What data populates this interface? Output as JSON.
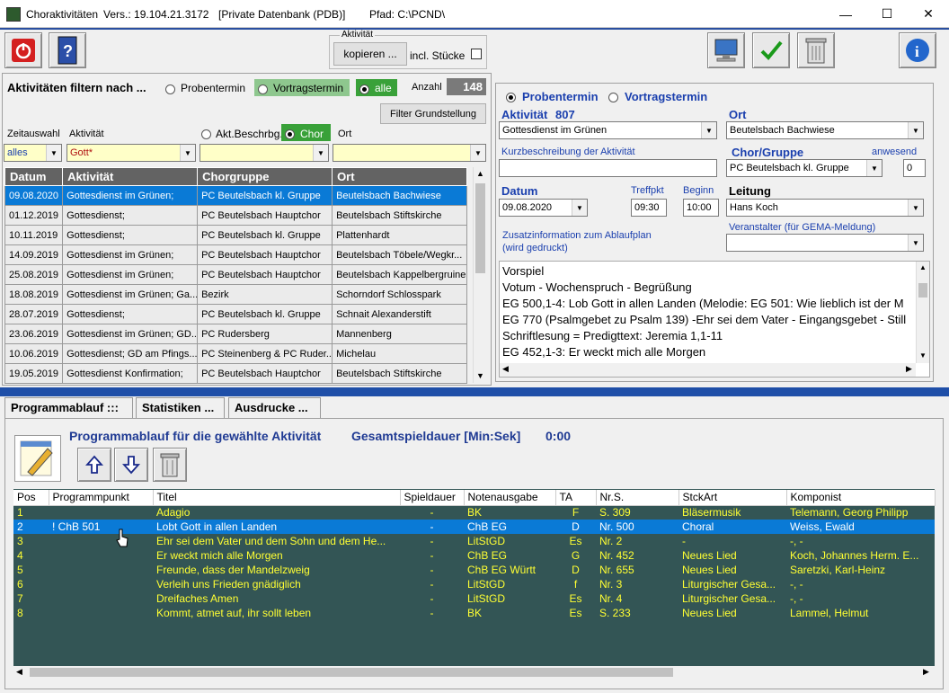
{
  "window": {
    "app_title": "Choraktivitäten",
    "version": "Vers.: 19.104.21.3172",
    "db": "[Private Datenbank (PDB)]",
    "path": "Pfad: C:\\PCND\\",
    "minimize": "—",
    "maximize": "☐",
    "close": "✕"
  },
  "toolbar": {
    "activity_group_label": "Aktivität",
    "copy_button": "kopieren ...",
    "incl_stuecke": "incl. Stücke"
  },
  "filter": {
    "title": "Aktivitäten filtern nach ...",
    "opt_probentermin": "Probentermin",
    "opt_vortragstermin": "Vortragstermin",
    "opt_alle": "alle",
    "anzahl_label": "Anzahl",
    "anzahl_value": "148",
    "grundstellung_button": "Filter Grundstellung",
    "zeitauswahl_label": "Zeitauswahl",
    "aktivitaet_label": "Aktivität",
    "akt_beschr_label": "Akt.Beschrbg.",
    "chor_label": "Chor",
    "ort_label": "Ort",
    "zeitauswahl_value": "alles",
    "aktivitaet_value": "Gott*",
    "chor_value": "",
    "ort_value": ""
  },
  "activities": {
    "headers": [
      "Datum",
      "Aktivität",
      "Chorgruppe",
      "Ort"
    ],
    "rows": [
      [
        "09.08.2020",
        "Gottesdienst im Grünen;",
        "PC Beutelsbach kl. Gruppe",
        "Beutelsbach Bachwiese"
      ],
      [
        "01.12.2019",
        "Gottesdienst;",
        "PC Beutelsbach Hauptchor",
        "Beutelsbach Stiftskirche"
      ],
      [
        "10.11.2019",
        "Gottesdienst;",
        "PC Beutelsbach kl. Gruppe",
        "Plattenhardt"
      ],
      [
        "14.09.2019",
        "Gottesdienst im Grünen;",
        "PC Beutelsbach Hauptchor",
        "Beutelsbach Töbele/Wegkr..."
      ],
      [
        "25.08.2019",
        "Gottesdienst im Grünen;",
        "PC Beutelsbach Hauptchor",
        "Beutelsbach Kappelbergruine"
      ],
      [
        "18.08.2019",
        "Gottesdienst im Grünen; Ga...",
        "Bezirk",
        "Schorndorf Schlosspark"
      ],
      [
        "28.07.2019",
        "Gottesdienst;",
        "PC Beutelsbach kl. Gruppe",
        "Schnait Alexanderstift"
      ],
      [
        "23.06.2019",
        "Gottesdienst im Grünen; GD...",
        "PC Rudersberg",
        "Mannenberg"
      ],
      [
        "10.06.2019",
        "Gottesdienst; GD am Pfings...",
        "PC Steinenberg & PC Ruder...",
        "Michelau"
      ],
      [
        "19.05.2019",
        "Gottesdienst Konfirmation;",
        "PC Beutelsbach Hauptchor",
        "Beutelsbach Stiftskirche"
      ]
    ]
  },
  "detail": {
    "opt_probentermin": "Probentermin",
    "opt_vortragstermin": "Vortragstermin",
    "aktivitaet_label": "Aktivität",
    "aktivitaet_id": "807",
    "aktivitaet_value": "Gottesdienst im Grünen",
    "ort_label": "Ort",
    "ort_value": "Beutelsbach Bachwiese",
    "kurz_label": "Kurzbeschreibung der Aktivität",
    "kurz_value": "",
    "chor_label": "Chor/Gruppe",
    "anwesend_label": "anwesend",
    "chor_value": "PC Beutelsbach kl. Gruppe",
    "anwesend_value": "0",
    "datum_label": "Datum",
    "treffpkt_label": "Treffpkt",
    "beginn_label": "Beginn",
    "leitung_label": "Leitung",
    "datum_value": "09.08.2020",
    "treffpkt_value": "09:30",
    "beginn_value": "10:00",
    "leitung_value": "Hans Koch",
    "zusatz_label_1": "Zusatzinformation zum Ablaufplan",
    "zusatz_label_2": "(wird gedruckt)",
    "veranstalter_label": "Veranstalter (für GEMA-Meldung)",
    "veranstalter_value": "",
    "agenda": [
      "Vorspiel",
      "Votum - Wochenspruch - Begrüßung",
      "EG 500,1-4: Lob Gott in allen Landen (Melodie: EG 501: Wie lieblich ist der M",
      "EG 770 (Psalmgebet zu Psalm 139) -Ehr sei dem Vater - Eingangsgebet - Still",
      "Schriftlesung = Predigttext: Jeremia 1,1-11",
      "EG 452,1-3: Er weckt mich alle Morgen"
    ]
  },
  "tabs": [
    "Programmablauf :::",
    "Statistiken ...",
    "Ausdrucke ..."
  ],
  "program": {
    "title": "Programmablauf für die gewählte Aktivität",
    "dauer_label": "Gesamtspieldauer [Min:Sek]",
    "dauer_value": "0:00",
    "headers": [
      "Pos",
      "Programmpunkt",
      "Titel",
      "Spieldauer",
      "Notenausgabe",
      "TA",
      "Nr.S.",
      "StckArt",
      "Komponist"
    ],
    "rows": [
      [
        "1",
        "",
        "Adagio",
        "-",
        "BK",
        "F",
        "S. 309",
        "Bläsermusik",
        "Telemann, Georg Philipp"
      ],
      [
        "2",
        "! ChB 501",
        "Lobt Gott in allen Landen",
        "-",
        "ChB EG",
        "D",
        "Nr. 500",
        "Choral",
        "Weiss, Ewald"
      ],
      [
        "3",
        "",
        "Ehr sei dem Vater und dem Sohn und dem He...",
        "-",
        "LitStGD",
        "Es",
        "Nr. 2",
        "-",
        "-, -"
      ],
      [
        "4",
        "",
        "Er weckt mich alle Morgen",
        "-",
        "ChB EG",
        "G",
        "Nr. 452",
        "Neues Lied",
        "Koch, Johannes Herm. E..."
      ],
      [
        "5",
        "",
        "Freunde, dass der Mandelzweig",
        "-",
        "ChB EG Württ",
        "D",
        "Nr. 655",
        "Neues Lied",
        "Saretzki, Karl-Heinz"
      ],
      [
        "6",
        "",
        "Verleih uns Frieden gnädiglich",
        "-",
        "LitStGD",
        "f",
        "Nr. 3",
        "Liturgischer Gesa...",
        "-, -"
      ],
      [
        "7",
        "",
        "Dreifaches Amen",
        "-",
        "LitStGD",
        "Es",
        "Nr. 4",
        "Liturgischer Gesa...",
        "-, -"
      ],
      [
        "8",
        "",
        "Kommt, atmet auf, ihr sollt leben",
        "-",
        "BK",
        "Es",
        "S. 233",
        "Neues Lied",
        "Lammel, Helmut"
      ]
    ]
  }
}
